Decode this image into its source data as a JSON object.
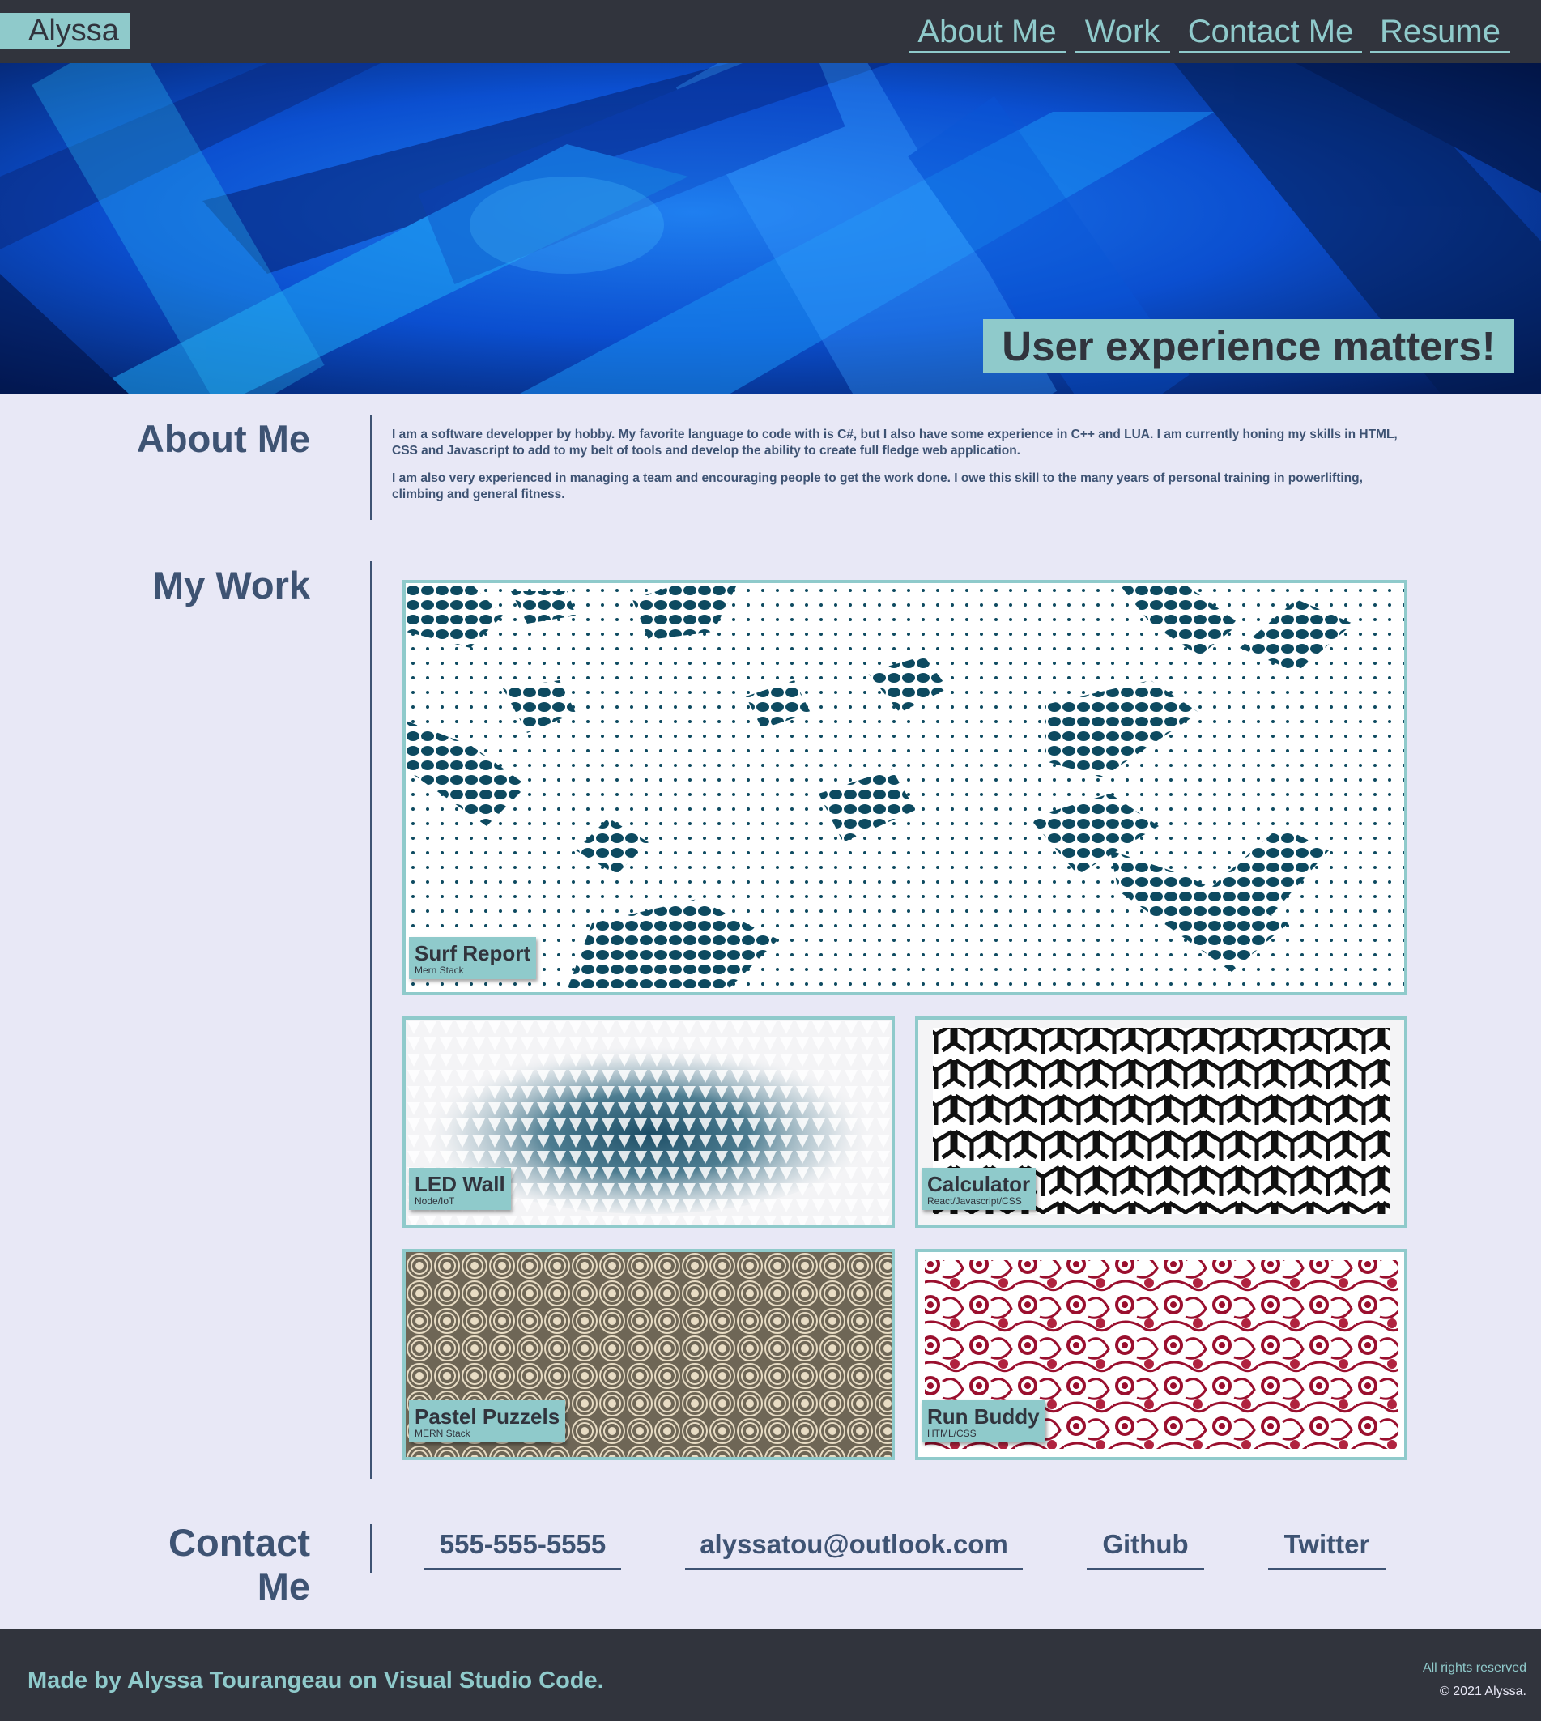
{
  "header": {
    "logo": "Alyssa",
    "nav": [
      "About Me",
      "Work",
      "Contact Me",
      "Resume"
    ]
  },
  "hero": {
    "tagline": "User experience matters!"
  },
  "about": {
    "title": "About Me",
    "paragraphs": [
      "I am a software developper by hobby. My favorite language to code with is C#, but I also have some experience in C++ and LUA. I am currently honing my skills in HTML, CSS and Javascript to add to my belt of tools and develop the ability to create full fledge web application.",
      "I am also very experienced in managing a team and encouraging people to get the work done. I owe this skill to the many years of personal training in powerlifting, climbing and general fitness."
    ]
  },
  "work": {
    "title": "My Work",
    "projects": [
      {
        "name": "Surf Report",
        "stack": "Mern Stack"
      },
      {
        "name": "LED Wall",
        "stack": "Node/IoT"
      },
      {
        "name": "Calculator",
        "stack": "React/Javascript/CSS"
      },
      {
        "name": "Pastel Puzzels",
        "stack": "MERN Stack"
      },
      {
        "name": "Run Buddy",
        "stack": "HTML/CSS"
      }
    ]
  },
  "contact": {
    "title_line1": "Contact",
    "title_line2": "Me",
    "phone": "555-555-5555",
    "email": "alyssatou@outlook.com",
    "github": "Github",
    "twitter": "Twitter"
  },
  "footer": {
    "made_by": "Made by Alyssa Tourangeau on Visual Studio Code.",
    "rights": "All rights reserved",
    "copyright": "© 2021 Alyssa."
  },
  "colors": {
    "dark": "#31343d",
    "accent": "#8fcacb",
    "background": "#e8e8f6",
    "text": "#3e5373"
  }
}
